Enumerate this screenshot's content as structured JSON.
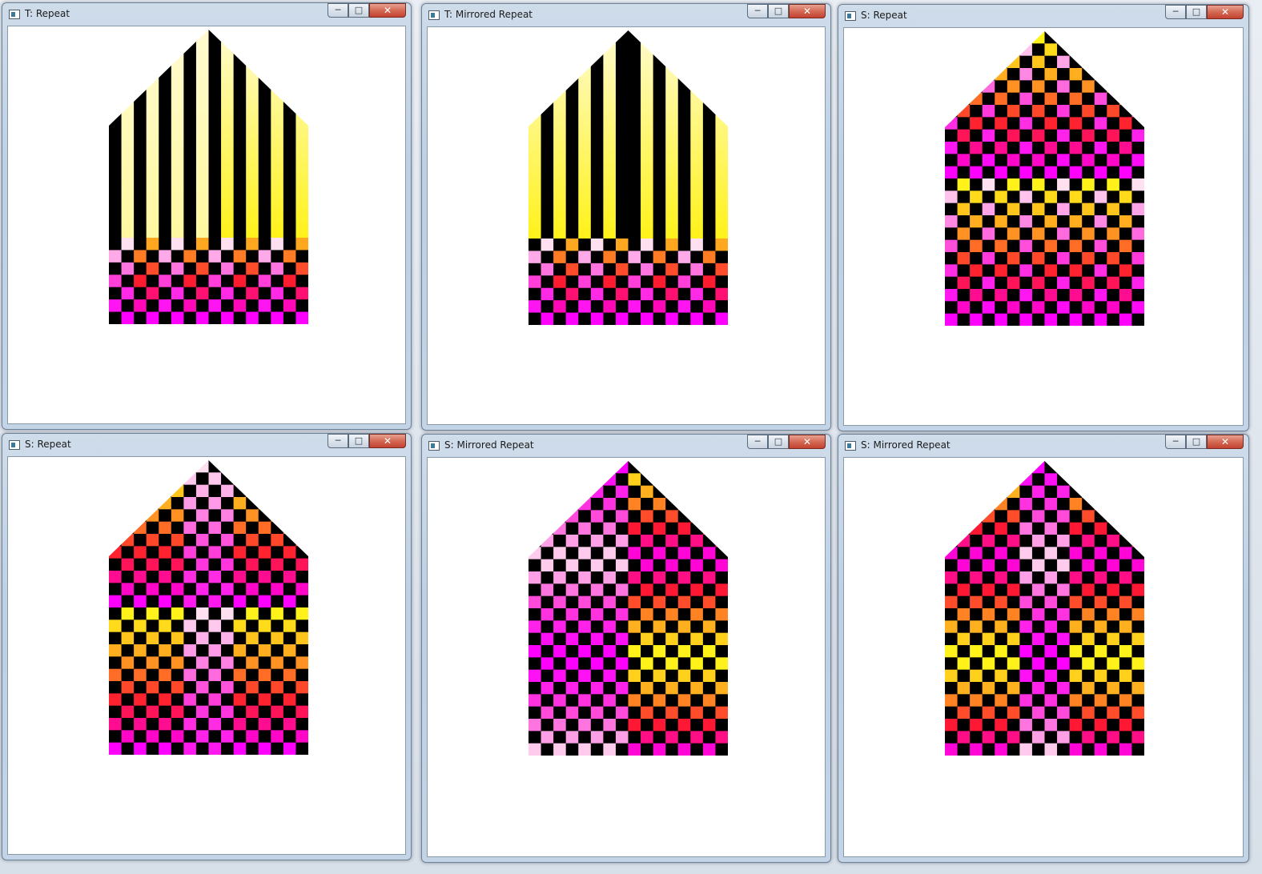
{
  "windows": [
    {
      "title": "T: Repeat",
      "mode": "t-repeat"
    },
    {
      "title": "T: Mirrored Repeat",
      "mode": "t-mirror"
    },
    {
      "title": "S: Repeat",
      "mode": "s-repeat-full"
    },
    {
      "title": "S: Repeat",
      "mode": "s-repeat-sym"
    },
    {
      "title": "S: Mirrored Repeat",
      "mode": "s-mirror-a"
    },
    {
      "title": "S: Mirrored Repeat",
      "mode": "s-mirror-b"
    }
  ],
  "controls": {
    "minimize": "─",
    "maximize": "□",
    "close": "✕"
  },
  "colors": {
    "stripe_light": "#fffbd0",
    "stripe_yellow": "#fff21a",
    "black": "#000000",
    "pink": "#ff3fd8",
    "magenta": "#ff00ff",
    "red": "#ff1830",
    "orange": "#ffa020"
  }
}
